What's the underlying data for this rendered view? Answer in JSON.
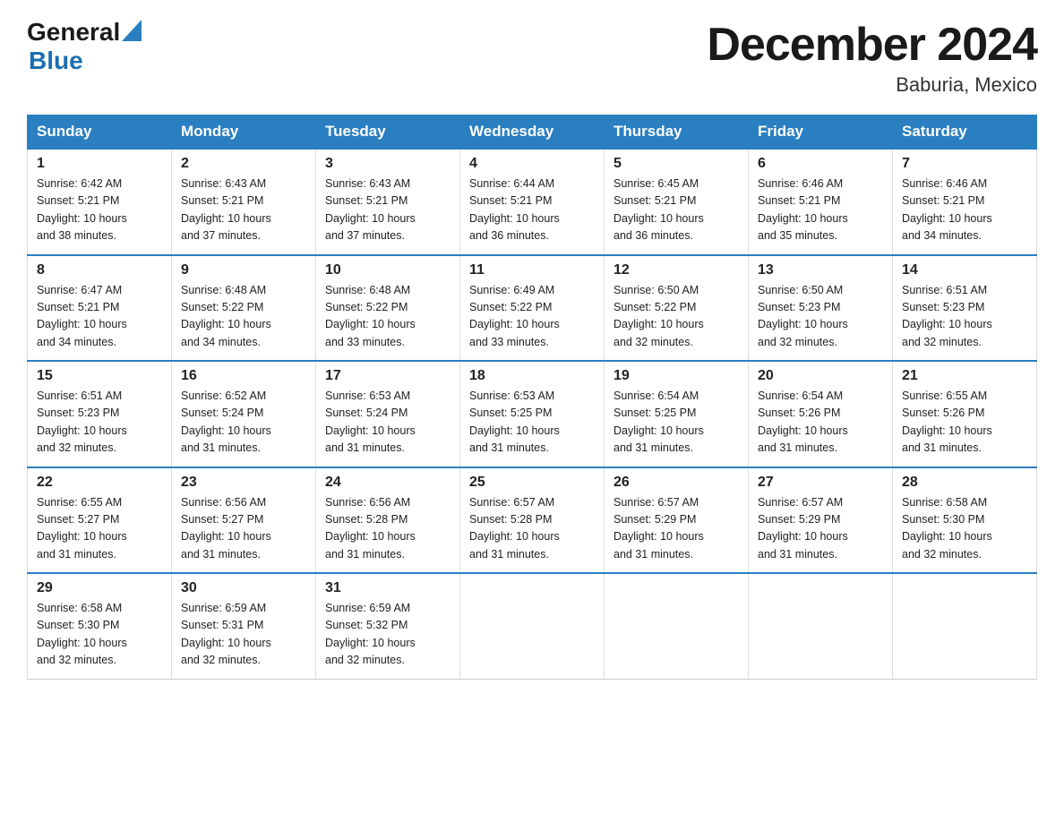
{
  "logo": {
    "text_general": "General",
    "text_blue": "Blue",
    "line2": "Blue"
  },
  "header": {
    "month": "December 2024",
    "location": "Baburia, Mexico"
  },
  "weekdays": [
    "Sunday",
    "Monday",
    "Tuesday",
    "Wednesday",
    "Thursday",
    "Friday",
    "Saturday"
  ],
  "weeks": [
    [
      {
        "day": "1",
        "sunrise": "6:42 AM",
        "sunset": "5:21 PM",
        "daylight": "10 hours and 38 minutes."
      },
      {
        "day": "2",
        "sunrise": "6:43 AM",
        "sunset": "5:21 PM",
        "daylight": "10 hours and 37 minutes."
      },
      {
        "day": "3",
        "sunrise": "6:43 AM",
        "sunset": "5:21 PM",
        "daylight": "10 hours and 37 minutes."
      },
      {
        "day": "4",
        "sunrise": "6:44 AM",
        "sunset": "5:21 PM",
        "daylight": "10 hours and 36 minutes."
      },
      {
        "day": "5",
        "sunrise": "6:45 AM",
        "sunset": "5:21 PM",
        "daylight": "10 hours and 36 minutes."
      },
      {
        "day": "6",
        "sunrise": "6:46 AM",
        "sunset": "5:21 PM",
        "daylight": "10 hours and 35 minutes."
      },
      {
        "day": "7",
        "sunrise": "6:46 AM",
        "sunset": "5:21 PM",
        "daylight": "10 hours and 34 minutes."
      }
    ],
    [
      {
        "day": "8",
        "sunrise": "6:47 AM",
        "sunset": "5:21 PM",
        "daylight": "10 hours and 34 minutes."
      },
      {
        "day": "9",
        "sunrise": "6:48 AM",
        "sunset": "5:22 PM",
        "daylight": "10 hours and 34 minutes."
      },
      {
        "day": "10",
        "sunrise": "6:48 AM",
        "sunset": "5:22 PM",
        "daylight": "10 hours and 33 minutes."
      },
      {
        "day": "11",
        "sunrise": "6:49 AM",
        "sunset": "5:22 PM",
        "daylight": "10 hours and 33 minutes."
      },
      {
        "day": "12",
        "sunrise": "6:50 AM",
        "sunset": "5:22 PM",
        "daylight": "10 hours and 32 minutes."
      },
      {
        "day": "13",
        "sunrise": "6:50 AM",
        "sunset": "5:23 PM",
        "daylight": "10 hours and 32 minutes."
      },
      {
        "day": "14",
        "sunrise": "6:51 AM",
        "sunset": "5:23 PM",
        "daylight": "10 hours and 32 minutes."
      }
    ],
    [
      {
        "day": "15",
        "sunrise": "6:51 AM",
        "sunset": "5:23 PM",
        "daylight": "10 hours and 32 minutes."
      },
      {
        "day": "16",
        "sunrise": "6:52 AM",
        "sunset": "5:24 PM",
        "daylight": "10 hours and 31 minutes."
      },
      {
        "day": "17",
        "sunrise": "6:53 AM",
        "sunset": "5:24 PM",
        "daylight": "10 hours and 31 minutes."
      },
      {
        "day": "18",
        "sunrise": "6:53 AM",
        "sunset": "5:25 PM",
        "daylight": "10 hours and 31 minutes."
      },
      {
        "day": "19",
        "sunrise": "6:54 AM",
        "sunset": "5:25 PM",
        "daylight": "10 hours and 31 minutes."
      },
      {
        "day": "20",
        "sunrise": "6:54 AM",
        "sunset": "5:26 PM",
        "daylight": "10 hours and 31 minutes."
      },
      {
        "day": "21",
        "sunrise": "6:55 AM",
        "sunset": "5:26 PM",
        "daylight": "10 hours and 31 minutes."
      }
    ],
    [
      {
        "day": "22",
        "sunrise": "6:55 AM",
        "sunset": "5:27 PM",
        "daylight": "10 hours and 31 minutes."
      },
      {
        "day": "23",
        "sunrise": "6:56 AM",
        "sunset": "5:27 PM",
        "daylight": "10 hours and 31 minutes."
      },
      {
        "day": "24",
        "sunrise": "6:56 AM",
        "sunset": "5:28 PM",
        "daylight": "10 hours and 31 minutes."
      },
      {
        "day": "25",
        "sunrise": "6:57 AM",
        "sunset": "5:28 PM",
        "daylight": "10 hours and 31 minutes."
      },
      {
        "day": "26",
        "sunrise": "6:57 AM",
        "sunset": "5:29 PM",
        "daylight": "10 hours and 31 minutes."
      },
      {
        "day": "27",
        "sunrise": "6:57 AM",
        "sunset": "5:29 PM",
        "daylight": "10 hours and 31 minutes."
      },
      {
        "day": "28",
        "sunrise": "6:58 AM",
        "sunset": "5:30 PM",
        "daylight": "10 hours and 32 minutes."
      }
    ],
    [
      {
        "day": "29",
        "sunrise": "6:58 AM",
        "sunset": "5:30 PM",
        "daylight": "10 hours and 32 minutes."
      },
      {
        "day": "30",
        "sunrise": "6:59 AM",
        "sunset": "5:31 PM",
        "daylight": "10 hours and 32 minutes."
      },
      {
        "day": "31",
        "sunrise": "6:59 AM",
        "sunset": "5:32 PM",
        "daylight": "10 hours and 32 minutes."
      },
      null,
      null,
      null,
      null
    ]
  ],
  "labels": {
    "sunrise": "Sunrise:",
    "sunset": "Sunset:",
    "daylight": "Daylight:"
  }
}
